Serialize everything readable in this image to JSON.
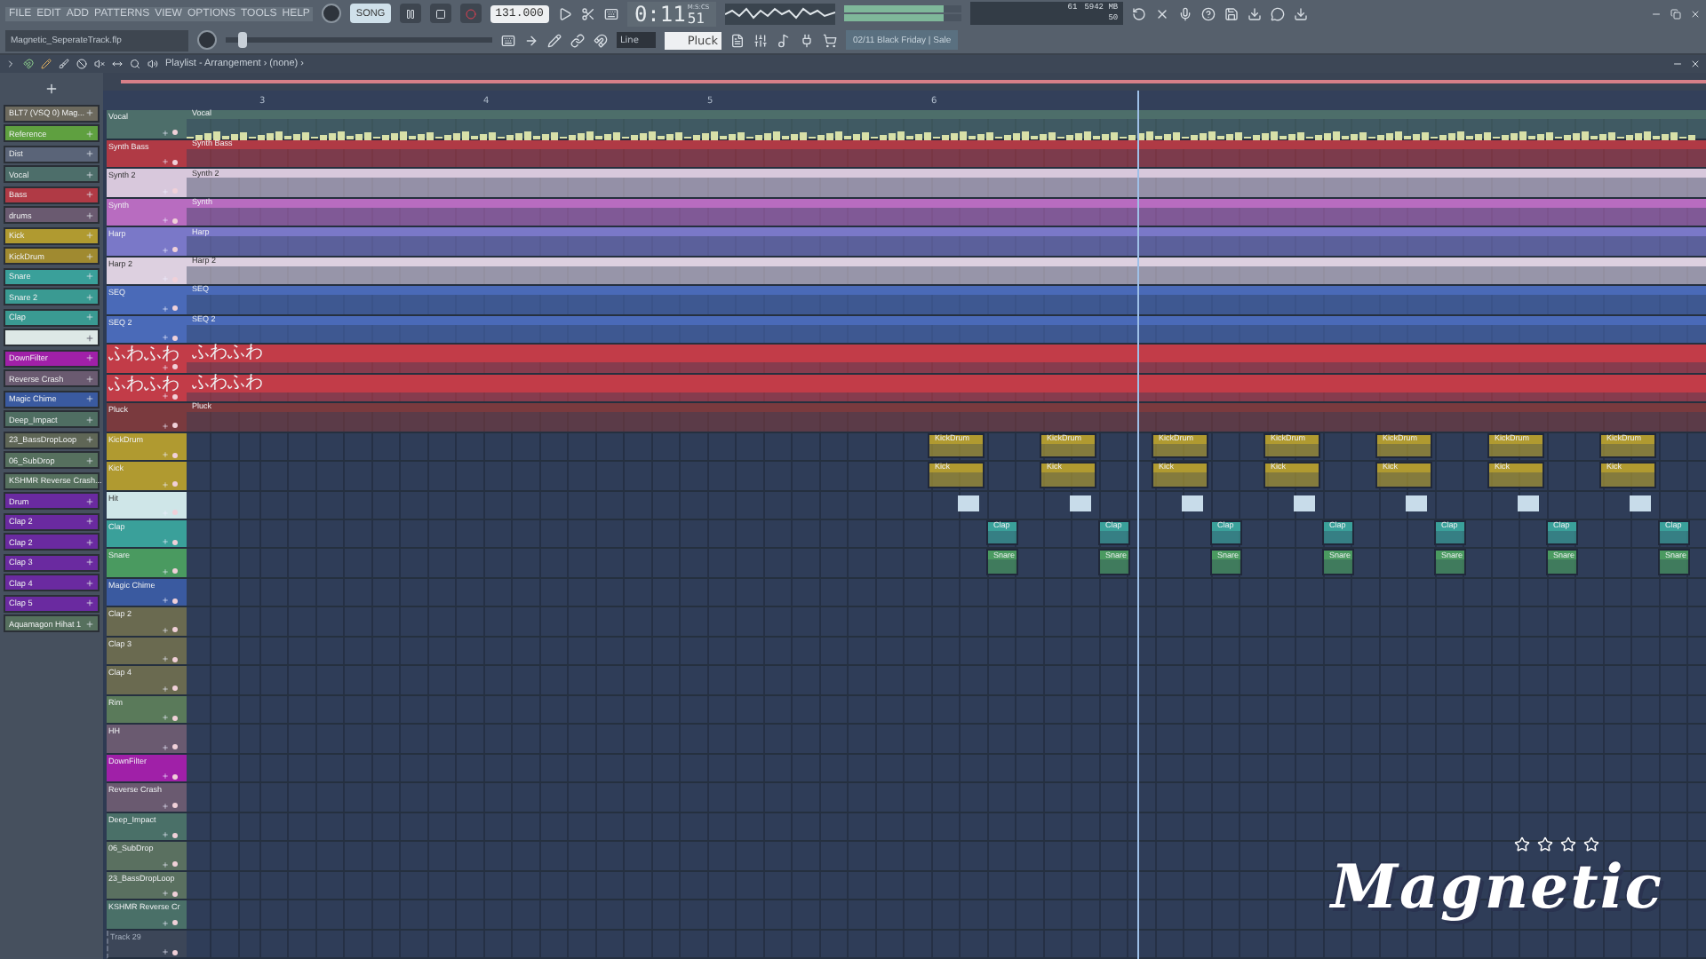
{
  "menu": [
    "FILE",
    "EDIT",
    "ADD",
    "PATTERNS",
    "VIEW",
    "OPTIONS",
    "TOOLS",
    "HELP"
  ],
  "file_name": "Magnetic_SeperateTrack.flp",
  "master_pitch": {
    "level": 0.05
  },
  "mode_label": "SONG",
  "tempo": "131.000",
  "time": {
    "main": "0:11",
    "fraction": "51",
    "unit": "M:S:CS"
  },
  "cpu": {
    "value": "61",
    "memory": "5942 MB",
    "polyphony": "50"
  },
  "snap": "Line",
  "pattern": "Pluck",
  "news": "02/11 Black Friday | Sale",
  "playlist_path": "Playlist - Arrangement › (none) ›",
  "ruler": [
    "3",
    "4",
    "5",
    "6"
  ],
  "channels": [
    {
      "name": "BLT7 (VSQ 0) Mag...",
      "color": "#6d6a5e"
    },
    {
      "name": "Reference",
      "color": "#5fa040"
    },
    {
      "name": "Dist",
      "color": "#5a6478"
    },
    {
      "name": "Vocal",
      "color": "#4d6e6a"
    },
    {
      "name": "Bass",
      "color": "#b03a45"
    },
    {
      "name": "drums",
      "color": "#6a5a70"
    },
    {
      "name": "Kick",
      "color": "#b09a30"
    },
    {
      "name": "KickDrum",
      "color": "#a08a30"
    },
    {
      "name": "Snare",
      "color": "#3aa09a"
    },
    {
      "name": "Snare 2",
      "color": "#3a9a92"
    },
    {
      "name": "Clap",
      "color": "#3a9a92"
    },
    {
      "color": "#dde8e6"
    },
    {
      "name": "DownFilter",
      "color": "#a020a8"
    },
    {
      "name": "Reverse Crash",
      "color": "#6a5a70"
    },
    {
      "name": "Magic Chime",
      "color": "#3a5aa0"
    },
    {
      "name": "Deep_Impact",
      "color": "#4f6e62"
    },
    {
      "name": "23_BassDropLoop",
      "color": "#5f6656"
    },
    {
      "name": "06_SubDrop",
      "color": "#56705e"
    },
    {
      "name": "KSHMR Reverse Crash...",
      "color": "#56705e"
    },
    {
      "name": "Drum",
      "color": "#6a2aa0"
    },
    {
      "name": "Clap 2",
      "color": "#6a2aa0"
    },
    {
      "name": "Clap 2",
      "color": "#6a2aa0"
    },
    {
      "name": "Clap 3",
      "color": "#6a2aa0"
    },
    {
      "name": "Clap 4",
      "color": "#6a2aa0"
    },
    {
      "name": "Clap 5",
      "color": "#6a2aa0"
    },
    {
      "name": "Aquamagon Hihat 1",
      "color": "#56705e"
    }
  ],
  "tracks": [
    {
      "name": "Vocal",
      "color": "#4d6e6a",
      "active": true,
      "kind": "audio",
      "clips": [
        "Vocal"
      ]
    },
    {
      "name": "Synth Bass",
      "color": "#b03a45",
      "active": true,
      "kind": "full",
      "clips": [
        "Synth Bass"
      ]
    },
    {
      "name": "Synth 2",
      "color": "#d8c8dc",
      "active": true,
      "kind": "full",
      "clips": [
        "Synth 2"
      ]
    },
    {
      "name": "Synth",
      "color": "#b86cc0",
      "active": true,
      "kind": "full",
      "clips": [
        "Synth"
      ]
    },
    {
      "name": "Harp",
      "color": "#7a78c8",
      "active": true,
      "kind": "full",
      "clips": [
        "Harp"
      ]
    },
    {
      "name": "Harp 2",
      "color": "#ddd0e0",
      "active": true,
      "kind": "full",
      "clips": [
        "Harp 2"
      ]
    },
    {
      "name": "SEQ",
      "color": "#4a6ab8",
      "active": true,
      "kind": "full",
      "clips": [
        "SEQ"
      ]
    },
    {
      "name": "SEQ 2",
      "color": "#4a6ab8",
      "active": true,
      "kind": "full",
      "clips": [
        "SEQ 2"
      ]
    },
    {
      "name": "ふわふわ",
      "color": "#c23c48",
      "active": true,
      "kind": "full",
      "clips": [
        "ふわふわ"
      ]
    },
    {
      "name": "ふわふわ",
      "color": "#c23c48",
      "active": true,
      "kind": "full",
      "clips": [
        "ふわふわ"
      ]
    },
    {
      "name": "Pluck",
      "color": "#7a3a3e",
      "active": true,
      "kind": "full",
      "clips": [
        "Pluck"
      ]
    },
    {
      "name": "KickDrum",
      "color": "#b09a30",
      "active": true,
      "kind": "beat",
      "clips": [
        "KickDrum",
        "KickDrum",
        "KickDrum",
        "KickDrum",
        "KickDrum",
        "KickDrum",
        "KickDrum"
      ]
    },
    {
      "name": "Kick",
      "color": "#b09a30",
      "active": true,
      "kind": "beat",
      "clips": [
        "Kick",
        "Kick",
        "Kick",
        "Kick",
        "Kick",
        "Kick",
        "Kick"
      ]
    },
    {
      "name": "Hit",
      "color": "#cfe6e8",
      "active": true,
      "kind": "hits"
    },
    {
      "name": "Clap",
      "color": "#3aa09a",
      "active": true,
      "kind": "offbeat",
      "clips": [
        "Clap",
        "Clap",
        "Clap",
        "Clap",
        "Clap",
        "Clap",
        "Clap"
      ]
    },
    {
      "name": "Snare",
      "color": "#4a9a60",
      "active": true,
      "kind": "offbeat",
      "clips": [
        "Snare",
        "Snare",
        "Snare",
        "Snare",
        "Snare",
        "Snare",
        "Snare"
      ]
    },
    {
      "name": "Magic Chime",
      "color": "#3a5aa0",
      "active": true,
      "kind": "empty"
    },
    {
      "name": "Clap 2",
      "color": "#6a6a50",
      "active": true,
      "kind": "empty"
    },
    {
      "name": "Clap 3",
      "color": "#6a6a50",
      "active": true,
      "kind": "empty"
    },
    {
      "name": "Clap 4",
      "color": "#6a6a50",
      "active": true,
      "kind": "empty"
    },
    {
      "name": "Rim",
      "color": "#5a7a5a",
      "active": true,
      "kind": "empty"
    },
    {
      "name": "HH",
      "color": "#6a5a70",
      "active": true,
      "kind": "empty"
    },
    {
      "name": "DownFilter",
      "color": "#a020a8",
      "active": true,
      "kind": "empty"
    },
    {
      "name": "Reverse Crash",
      "color": "#6a5a70",
      "active": true,
      "kind": "empty"
    },
    {
      "name": "Deep_Impact",
      "color": "#4a7068",
      "active": true,
      "kind": "empty"
    },
    {
      "name": "06_SubDrop",
      "color": "#5a7060",
      "active": true,
      "kind": "empty"
    },
    {
      "name": "23_BassDropLoop",
      "color": "#5a7060",
      "active": true,
      "kind": "empty"
    },
    {
      "name": "KSHMR Reverse Cr",
      "color": "#4a7068",
      "active": true,
      "kind": "empty"
    },
    {
      "name": "Track 29",
      "color": "#3c4658",
      "active": false,
      "kind": "empty"
    }
  ],
  "logo": "Magnetic"
}
